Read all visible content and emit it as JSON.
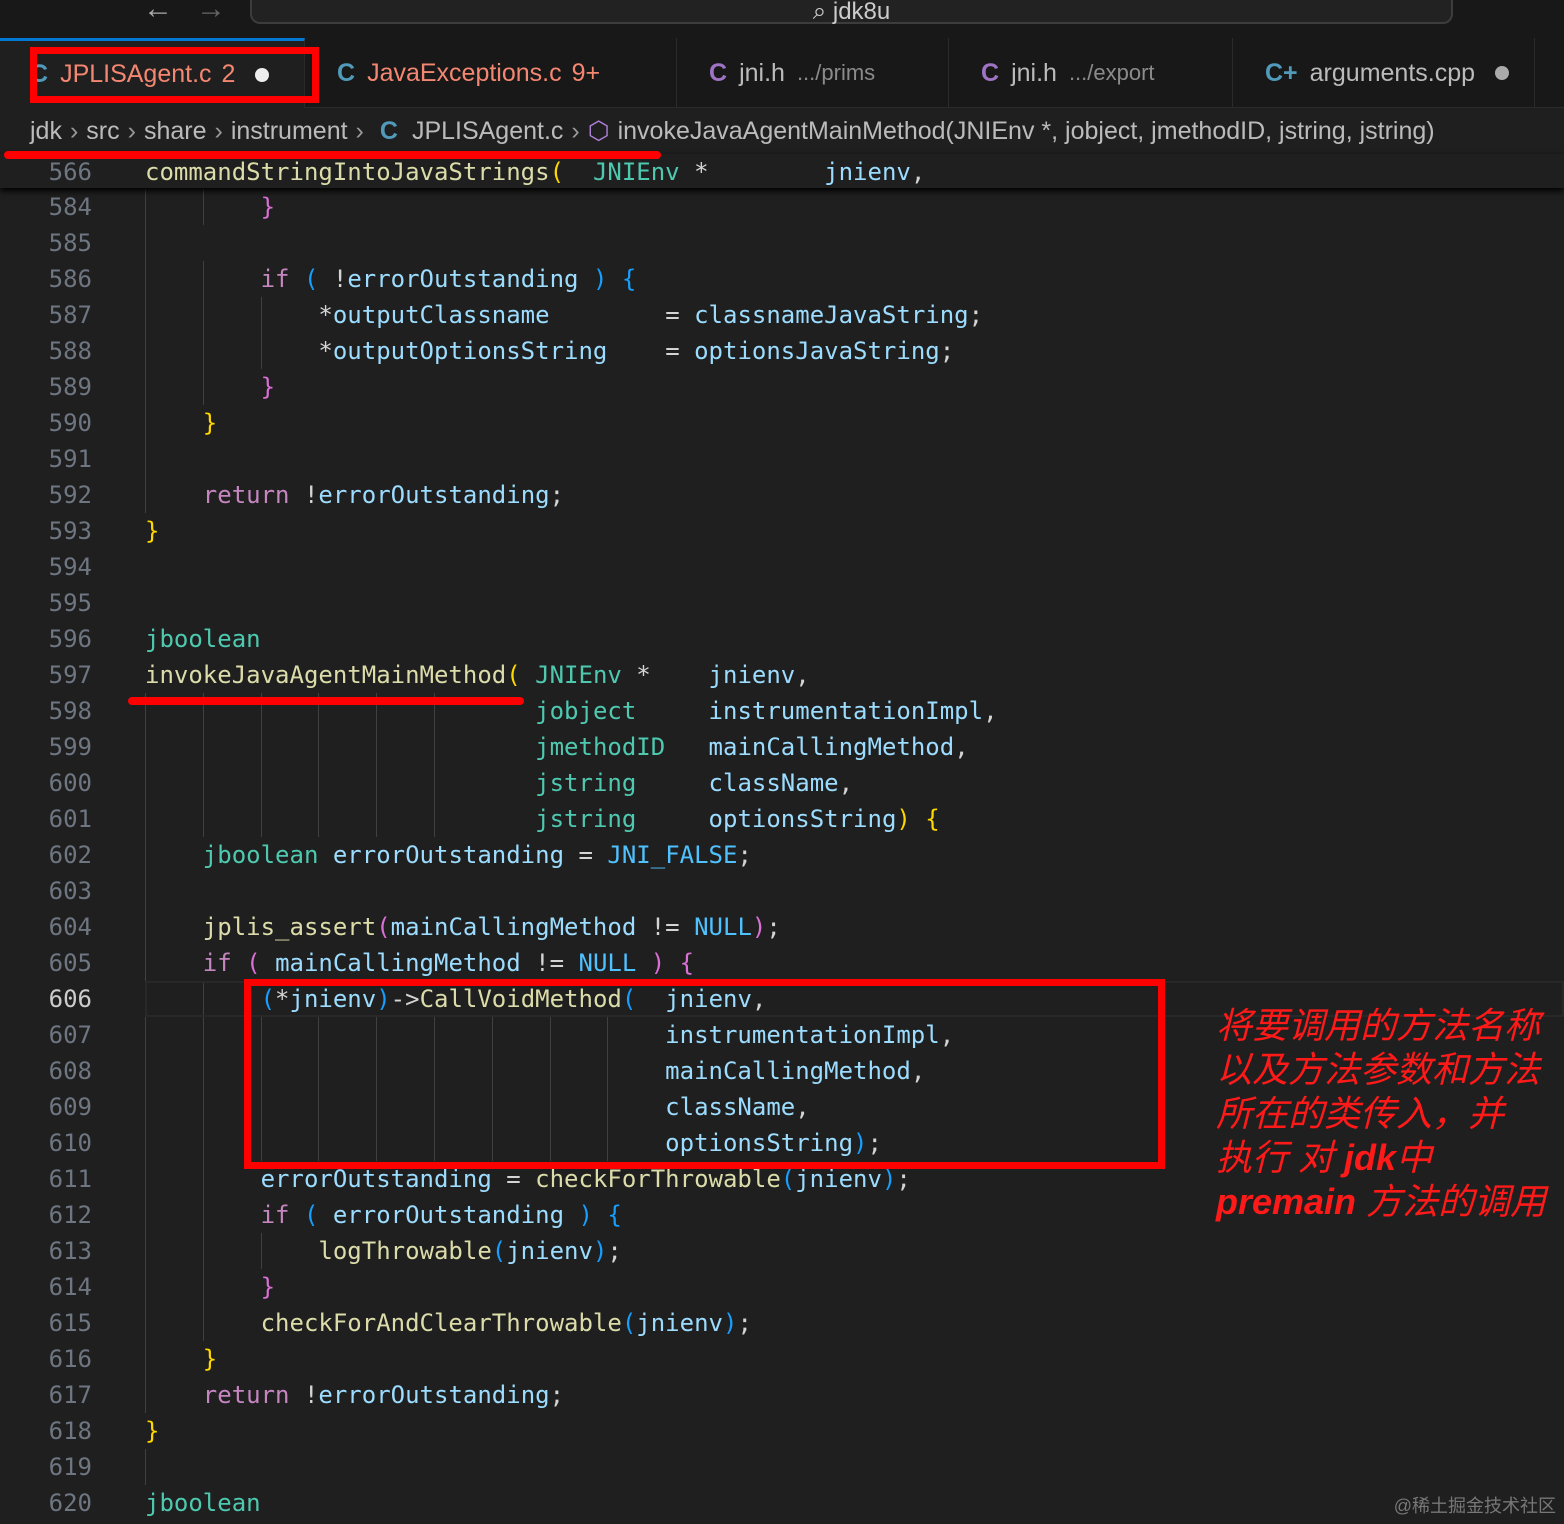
{
  "titlebar": {
    "back_icon": "←",
    "forward_icon": "→",
    "search_icon": "⌕",
    "search_text": "jdk8u"
  },
  "tabs": [
    {
      "icon": "C",
      "icon_color": "#519aba",
      "name": "JPLISAgent.c",
      "badge": "2",
      "name_color": "#f48771",
      "modified": true,
      "active": true
    },
    {
      "icon": "C",
      "icon_color": "#519aba",
      "name": "JavaExceptions.c",
      "badge": "9+",
      "name_color": "#f48771",
      "modified": false,
      "active": false
    },
    {
      "icon": "C",
      "icon_color": "#a074c4",
      "name": "jni.h",
      "desc": ".../prims",
      "name_color": "#bbbbbb"
    },
    {
      "icon": "C",
      "icon_color": "#a074c4",
      "name": "jni.h",
      "desc": ".../export",
      "name_color": "#bbbbbb"
    },
    {
      "icon": "C+",
      "icon_color": "#519aba",
      "name": "arguments.cpp",
      "name_color": "#bbbbbb",
      "modified": true
    }
  ],
  "breadcrumb": {
    "items": [
      "jdk",
      "src",
      "share",
      "instrument"
    ],
    "file": "JPLISAgent.c",
    "symbol": "invokeJavaAgentMainMethod(JNIEnv *, jobject, jmethodID, jstring, jstring)"
  },
  "sticky": {
    "number": "566",
    "text": "commandStringIntoJavaStrings(  JNIEnv *        jnienv,"
  },
  "current_line": "606",
  "lines": [
    {
      "n": "584",
      "t": "        }"
    },
    {
      "n": "585",
      "t": ""
    },
    {
      "n": "586",
      "t": "        if ( !errorOutstanding ) {"
    },
    {
      "n": "587",
      "t": "            *outputClassname        = classnameJavaString;"
    },
    {
      "n": "588",
      "t": "            *outputOptionsString    = optionsJavaString;"
    },
    {
      "n": "589",
      "t": "        }"
    },
    {
      "n": "590",
      "t": "    }"
    },
    {
      "n": "591",
      "t": ""
    },
    {
      "n": "592",
      "t": "    return !errorOutstanding;"
    },
    {
      "n": "593",
      "t": "}"
    },
    {
      "n": "594",
      "t": ""
    },
    {
      "n": "595",
      "t": ""
    },
    {
      "n": "596",
      "t": "jboolean"
    },
    {
      "n": "597",
      "t": "invokeJavaAgentMainMethod( JNIEnv *    jnienv,"
    },
    {
      "n": "598",
      "t": "                           jobject     instrumentationImpl,"
    },
    {
      "n": "599",
      "t": "                           jmethodID   mainCallingMethod,"
    },
    {
      "n": "600",
      "t": "                           jstring     className,"
    },
    {
      "n": "601",
      "t": "                           jstring     optionsString) {"
    },
    {
      "n": "602",
      "t": "    jboolean errorOutstanding = JNI_FALSE;"
    },
    {
      "n": "603",
      "t": ""
    },
    {
      "n": "604",
      "t": "    jplis_assert(mainCallingMethod != NULL);"
    },
    {
      "n": "605",
      "t": "    if ( mainCallingMethod != NULL ) {"
    },
    {
      "n": "606",
      "t": "        (*jnienv)->CallVoidMethod(  jnienv,"
    },
    {
      "n": "607",
      "t": "                                    instrumentationImpl,"
    },
    {
      "n": "608",
      "t": "                                    mainCallingMethod,"
    },
    {
      "n": "609",
      "t": "                                    className,"
    },
    {
      "n": "610",
      "t": "                                    optionsString);"
    },
    {
      "n": "611",
      "t": "        errorOutstanding = checkForThrowable(jnienv);"
    },
    {
      "n": "612",
      "t": "        if ( errorOutstanding ) {"
    },
    {
      "n": "613",
      "t": "            logThrowable(jnienv);"
    },
    {
      "n": "614",
      "t": "        }"
    },
    {
      "n": "615",
      "t": "        checkForAndClearThrowable(jnienv);"
    },
    {
      "n": "616",
      "t": "    }"
    },
    {
      "n": "617",
      "t": "    return !errorOutstanding;"
    },
    {
      "n": "618",
      "t": "}"
    },
    {
      "n": "619",
      "t": ""
    },
    {
      "n": "620",
      "t": "jboolean"
    }
  ],
  "annotation": {
    "line1": "将要调用的方法名称",
    "line2": "以及方法参数和方法",
    "line3": "所在的类传入，并",
    "line4a": "执行 对 ",
    "line4b": "jdk",
    "line4c": "中",
    "line5a": "premain",
    "line5b": " 方法的调用"
  },
  "watermark": "@稀土掘金技术社区",
  "colors": {
    "keyword": "#c586c0",
    "function": "#dcdcaa",
    "type": "#4ec9b0",
    "variable": "#9cdcfe",
    "constant": "#4fc1ff",
    "annotation": "#ff0000",
    "accent": "#0078d4"
  }
}
